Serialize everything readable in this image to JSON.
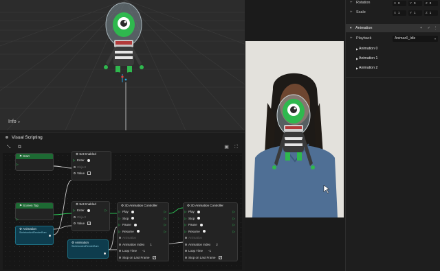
{
  "viewport": {
    "info_label": "Info"
  },
  "visual_scripting": {
    "title": "Visual Scripting",
    "nodes": {
      "start": {
        "title": "Start"
      },
      "set_enabled_1": {
        "title": "Set Enabled",
        "rows": [
          "Enter",
          "Object",
          "Value"
        ]
      },
      "screen_tap": {
        "title": "Screen Tap"
      },
      "set_enabled_2": {
        "title": "Set Enabled",
        "rows": [
          "Enter",
          "Object",
          "Value"
        ]
      },
      "animation_1": {
        "title": "Animation",
        "sub": "SkeletonAndRenderBum"
      },
      "animation_2": {
        "title": "Animation",
        "sub": "SkeletonAndRenderBum"
      },
      "controller_1": {
        "title": "3D Animation Controller",
        "rows": [
          "Play",
          "Stop",
          "Pause",
          "Resume",
          "Animation",
          "Animation Index",
          "Loop Time",
          "Stop on Last Frame"
        ],
        "index_value": "1",
        "loop_value": "-1"
      },
      "controller_2": {
        "title": "3D Animation Controller",
        "rows": [
          "Play",
          "Stop",
          "Pause",
          "Resume",
          "Animation",
          "Animation Index",
          "Loop Time",
          "Stop on Last Frame"
        ],
        "index_value": "2",
        "loop_value": "-1"
      }
    }
  },
  "inspector": {
    "rotation": {
      "label": "Rotation",
      "x": "0",
      "y": "0",
      "z": "0"
    },
    "scale": {
      "label": "Scale",
      "x": "1",
      "y": "1",
      "z": "1"
    },
    "animation_section": "Animation",
    "playback": {
      "label": "Playback",
      "value": "Animaz0_Idle"
    },
    "animations": [
      "Animation 0",
      "Animation 1",
      "Animation 2"
    ]
  },
  "colors": {
    "node_green": "#1d6a33",
    "node_teal": "#0e3c4d",
    "exec_arrow": "#2ecf5a",
    "character_green": "#2fb84e"
  },
  "icons": [
    "info-caret-icon",
    "snap-icon",
    "align-icon",
    "fit-view-icon",
    "fullscreen-icon",
    "add-icon",
    "check-icon",
    "more-icon"
  ]
}
